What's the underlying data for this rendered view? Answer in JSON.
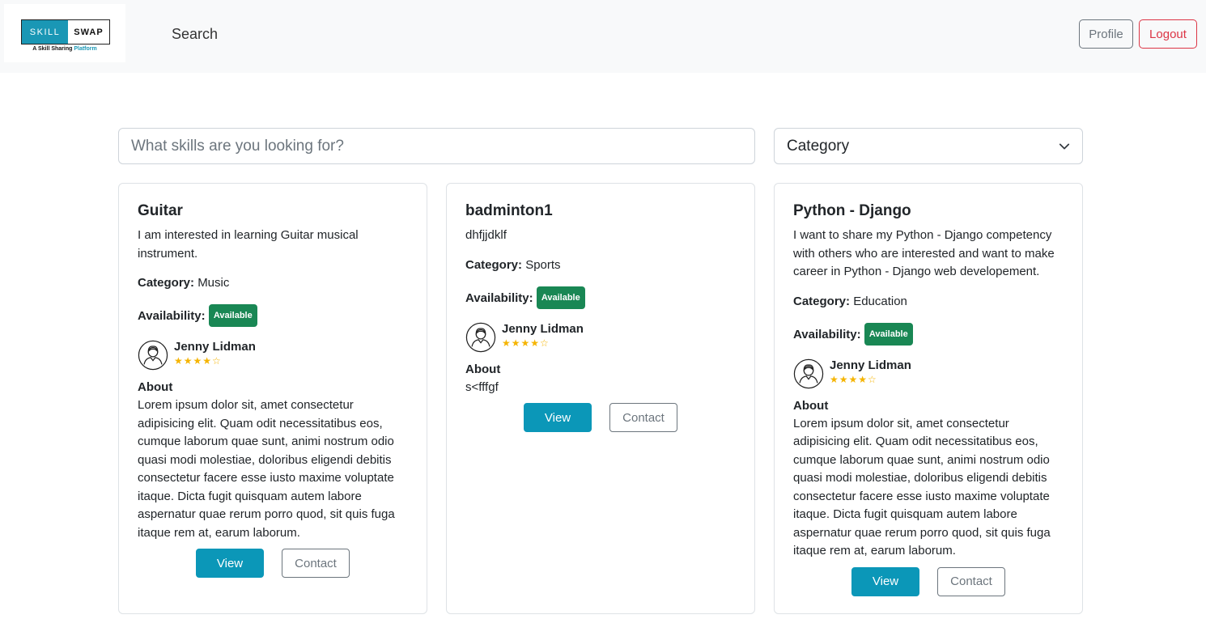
{
  "navbar": {
    "logo": {
      "left": "SKILL",
      "right": "SWAP",
      "tagline": "A Skill Sharing",
      "tagline_accent": "Platform"
    },
    "search_link": "Search",
    "profile_label": "Profile",
    "logout_label": "Logout"
  },
  "search": {
    "placeholder": "What skills are you looking for?",
    "value": ""
  },
  "category_select": {
    "selected": "Category"
  },
  "labels": {
    "category": "Category:",
    "availability": "Availability:",
    "about": "About",
    "view": "View",
    "contact": "Contact"
  },
  "cards": [
    {
      "title": "Guitar",
      "description": "I am interested in learning Guitar musical instrument.",
      "category": "Music",
      "availability": "Available",
      "user": {
        "name": "Jenny Lidman",
        "rating": 4,
        "stars": "★★★★☆"
      },
      "about": "Lorem ipsum dolor sit, amet consectetur adipisicing elit. Quam odit necessitatibus eos, cumque laborum quae sunt, animi nostrum odio quasi modi molestiae, doloribus eligendi debitis consectetur facere esse iusto maxime voluptate itaque. Dicta fugit quisquam autem labore aspernatur quae rerum porro quod, sit quis fuga itaque rem at, earum laborum."
    },
    {
      "title": "badminton1",
      "description": "dhfjjdklf",
      "category": "Sports",
      "availability": "Available",
      "user": {
        "name": "Jenny Lidman",
        "rating": 4,
        "stars": "★★★★☆"
      },
      "about": "s<fffgf"
    },
    {
      "title": "Python - Django",
      "description": "I want to share my Python - Django competency with others who are interested and want to make career in Python - Django web developement.",
      "category": "Education",
      "availability": "Available",
      "user": {
        "name": "Jenny Lidman",
        "rating": 4,
        "stars": "★★★★☆"
      },
      "about": "Lorem ipsum dolor sit, amet consectetur adipisicing elit. Quam odit necessitatibus eos, cumque laborum quae sunt, animi nostrum odio quasi modi molestiae, doloribus eligendi debitis consectetur facere esse iusto maxime voluptate itaque. Dicta fugit quisquam autem labore aspernatur quae rerum porro quod, sit quis fuga itaque rem at, earum laborum."
    }
  ],
  "colors": {
    "primary": "#0b97b8",
    "success": "#198754",
    "danger": "#dc3545",
    "secondary": "#6c757d",
    "star": "#f5b400",
    "navbar_bg": "#f8f9fa"
  },
  "icons": {
    "user_avatar": "user-avatar-icon",
    "dropdown": "chevron-down-icon"
  }
}
